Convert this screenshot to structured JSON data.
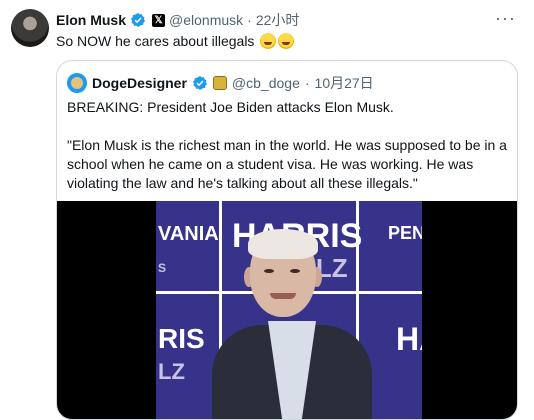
{
  "tweet": {
    "author_name": "Elon Musk",
    "handle": "@elonmusk",
    "separator": "·",
    "time": "22小时",
    "text": "So NOW he cares about illegals",
    "emoji": "🤣🤣",
    "more_label": "···"
  },
  "quoted": {
    "author_name": "DogeDesigner",
    "handle": "@cb_doge",
    "separator": "·",
    "date": "10月27日",
    "body": "BREAKING: President Joe Biden attacks Elon Musk.\n\n\"Elon Musk is the richest man in the world. He was supposed to be in a school when he came on a student visa. He was working. He was violating the law and he's talking about all these illegals.\""
  },
  "video": {
    "signs": {
      "left_top": "VANIA",
      "left_mid": "S",
      "center_top": "HARRIS",
      "center_bottom": "WALZ",
      "right_top": "PEN",
      "left_bottom": "RIS",
      "left_bottom2": "LZ",
      "right_bottom": "HA"
    }
  },
  "colors": {
    "verified_blue": "#1d9bf0",
    "muted": "#536471",
    "border": "#cfd9de",
    "backdrop_purple": "#38338a"
  }
}
